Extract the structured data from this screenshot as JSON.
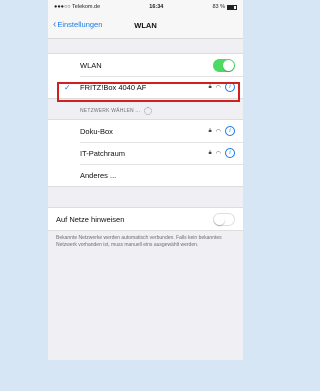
{
  "status": {
    "carrier": "●●●○○ Telekom.de",
    "time": "16:34",
    "battery": "83 %"
  },
  "nav": {
    "back_label": "Einstellungen",
    "title": "WLAN"
  },
  "wlan": {
    "label": "WLAN",
    "toggle_on": true
  },
  "connected": {
    "check": "✓",
    "name": "FRITZ!Box 4040 AF"
  },
  "section": {
    "header": "NETZWERK WÄHLEN ..."
  },
  "networks": [
    {
      "name": "Doku-Box"
    },
    {
      "name": "IT-Patchraum"
    },
    {
      "name": "Anderes ..."
    }
  ],
  "ask": {
    "label": "Auf Netze hinweisen",
    "toggle_on": false,
    "footer": "Bekannte Netzwerke werden automatisch verbunden. Falls kein bekanntes Netzwerk vorhanden ist, muss manuell eins ausgewählt werden."
  },
  "colors": {
    "accent": "#1a7bea",
    "toggle_on": "#4cd964",
    "highlight": "#d21f1f",
    "background": "#d6e6f4"
  }
}
